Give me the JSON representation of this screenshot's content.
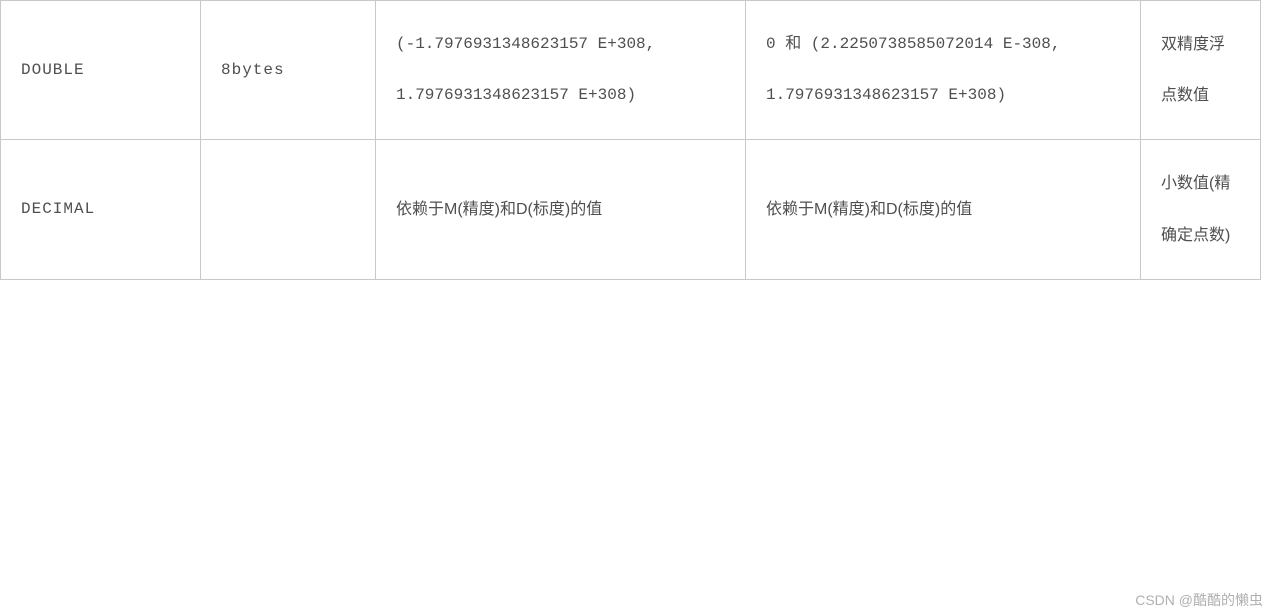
{
  "table": {
    "rows": [
      {
        "type": "DOUBLE",
        "size": "8bytes",
        "signed_range": "(-1.7976931348623157 E+308, 1.7976931348623157 E+308)",
        "unsigned_range": "0 和 (2.2250738585072014 E-308, 1.7976931348623157 E+308)",
        "description": "双精度浮点数值"
      },
      {
        "type": "DECIMAL",
        "size": "",
        "signed_range": "依赖于M(精度)和D(标度)的值",
        "unsigned_range": "依赖于M(精度)和D(标度)的值",
        "description": "小数值(精确定点数)"
      }
    ]
  },
  "watermark": "CSDN @酷酷的懒虫"
}
